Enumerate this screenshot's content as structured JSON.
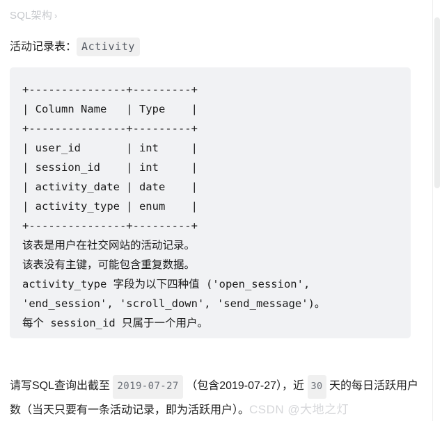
{
  "breadcrumb": {
    "label": "SQL架构",
    "separator": "›"
  },
  "heading": {
    "prefix": "活动记录表：",
    "table_name": "Activity"
  },
  "code_block": {
    "schema_table": [
      "+---------------+---------+",
      "| Column Name   | Type    |",
      "+---------------+---------+",
      "| user_id       | int     |",
      "| session_id    | int     |",
      "| activity_date | date    |",
      "| activity_type | enum    |",
      "+---------------+---------+"
    ],
    "columns": [
      {
        "name": "user_id",
        "type": "int"
      },
      {
        "name": "session_id",
        "type": "int"
      },
      {
        "name": "activity_date",
        "type": "date"
      },
      {
        "name": "activity_type",
        "type": "enum"
      }
    ],
    "header_row": {
      "name": "Column Name",
      "type": "Type"
    },
    "notes": [
      "该表是用户在社交网站的活动记录。",
      "该表没有主键，可能包含重复数据。",
      "activity_type 字段为以下四种值 ('open_session',",
      "'end_session', 'scroll_down', 'send_message')。",
      "每个 session_id 只属于一个用户。"
    ],
    "enum_values": [
      "open_session",
      "end_session",
      "scroll_down",
      "send_message"
    ]
  },
  "question": {
    "part1": "请写SQL查询出截至 ",
    "date_badge": "2019-07-27",
    "part2": " （包含2019-07-27），近 ",
    "days_badge": "30",
    "part3": " 天的每日活跃用户数（当天只要有一条活动记录，即为活跃用户）。",
    "watermark": "CSDN @大地之灯"
  }
}
